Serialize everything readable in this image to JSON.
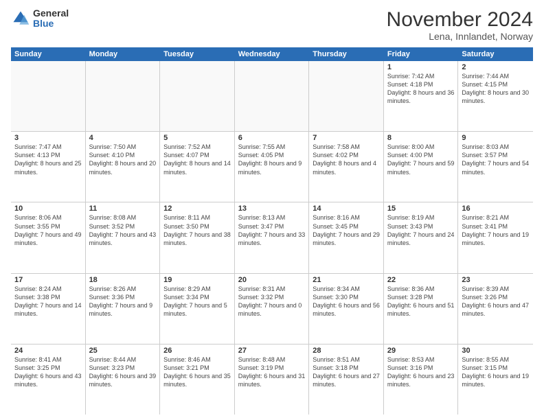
{
  "logo": {
    "general": "General",
    "blue": "Blue"
  },
  "title": "November 2024",
  "subtitle": "Lena, Innlandet, Norway",
  "header_days": [
    "Sunday",
    "Monday",
    "Tuesday",
    "Wednesday",
    "Thursday",
    "Friday",
    "Saturday"
  ],
  "rows": [
    [
      {
        "day": "",
        "detail": "",
        "empty": true
      },
      {
        "day": "",
        "detail": "",
        "empty": true
      },
      {
        "day": "",
        "detail": "",
        "empty": true
      },
      {
        "day": "",
        "detail": "",
        "empty": true
      },
      {
        "day": "",
        "detail": "",
        "empty": true
      },
      {
        "day": "1",
        "detail": "Sunrise: 7:42 AM\nSunset: 4:18 PM\nDaylight: 8 hours\nand 36 minutes.",
        "empty": false
      },
      {
        "day": "2",
        "detail": "Sunrise: 7:44 AM\nSunset: 4:15 PM\nDaylight: 8 hours\nand 30 minutes.",
        "empty": false
      }
    ],
    [
      {
        "day": "3",
        "detail": "Sunrise: 7:47 AM\nSunset: 4:13 PM\nDaylight: 8 hours\nand 25 minutes.",
        "empty": false
      },
      {
        "day": "4",
        "detail": "Sunrise: 7:50 AM\nSunset: 4:10 PM\nDaylight: 8 hours\nand 20 minutes.",
        "empty": false
      },
      {
        "day": "5",
        "detail": "Sunrise: 7:52 AM\nSunset: 4:07 PM\nDaylight: 8 hours\nand 14 minutes.",
        "empty": false
      },
      {
        "day": "6",
        "detail": "Sunrise: 7:55 AM\nSunset: 4:05 PM\nDaylight: 8 hours\nand 9 minutes.",
        "empty": false
      },
      {
        "day": "7",
        "detail": "Sunrise: 7:58 AM\nSunset: 4:02 PM\nDaylight: 8 hours\nand 4 minutes.",
        "empty": false
      },
      {
        "day": "8",
        "detail": "Sunrise: 8:00 AM\nSunset: 4:00 PM\nDaylight: 7 hours\nand 59 minutes.",
        "empty": false
      },
      {
        "day": "9",
        "detail": "Sunrise: 8:03 AM\nSunset: 3:57 PM\nDaylight: 7 hours\nand 54 minutes.",
        "empty": false
      }
    ],
    [
      {
        "day": "10",
        "detail": "Sunrise: 8:06 AM\nSunset: 3:55 PM\nDaylight: 7 hours\nand 49 minutes.",
        "empty": false
      },
      {
        "day": "11",
        "detail": "Sunrise: 8:08 AM\nSunset: 3:52 PM\nDaylight: 7 hours\nand 43 minutes.",
        "empty": false
      },
      {
        "day": "12",
        "detail": "Sunrise: 8:11 AM\nSunset: 3:50 PM\nDaylight: 7 hours\nand 38 minutes.",
        "empty": false
      },
      {
        "day": "13",
        "detail": "Sunrise: 8:13 AM\nSunset: 3:47 PM\nDaylight: 7 hours\nand 33 minutes.",
        "empty": false
      },
      {
        "day": "14",
        "detail": "Sunrise: 8:16 AM\nSunset: 3:45 PM\nDaylight: 7 hours\nand 29 minutes.",
        "empty": false
      },
      {
        "day": "15",
        "detail": "Sunrise: 8:19 AM\nSunset: 3:43 PM\nDaylight: 7 hours\nand 24 minutes.",
        "empty": false
      },
      {
        "day": "16",
        "detail": "Sunrise: 8:21 AM\nSunset: 3:41 PM\nDaylight: 7 hours\nand 19 minutes.",
        "empty": false
      }
    ],
    [
      {
        "day": "17",
        "detail": "Sunrise: 8:24 AM\nSunset: 3:38 PM\nDaylight: 7 hours\nand 14 minutes.",
        "empty": false
      },
      {
        "day": "18",
        "detail": "Sunrise: 8:26 AM\nSunset: 3:36 PM\nDaylight: 7 hours\nand 9 minutes.",
        "empty": false
      },
      {
        "day": "19",
        "detail": "Sunrise: 8:29 AM\nSunset: 3:34 PM\nDaylight: 7 hours\nand 5 minutes.",
        "empty": false
      },
      {
        "day": "20",
        "detail": "Sunrise: 8:31 AM\nSunset: 3:32 PM\nDaylight: 7 hours\nand 0 minutes.",
        "empty": false
      },
      {
        "day": "21",
        "detail": "Sunrise: 8:34 AM\nSunset: 3:30 PM\nDaylight: 6 hours\nand 56 minutes.",
        "empty": false
      },
      {
        "day": "22",
        "detail": "Sunrise: 8:36 AM\nSunset: 3:28 PM\nDaylight: 6 hours\nand 51 minutes.",
        "empty": false
      },
      {
        "day": "23",
        "detail": "Sunrise: 8:39 AM\nSunset: 3:26 PM\nDaylight: 6 hours\nand 47 minutes.",
        "empty": false
      }
    ],
    [
      {
        "day": "24",
        "detail": "Sunrise: 8:41 AM\nSunset: 3:25 PM\nDaylight: 6 hours\nand 43 minutes.",
        "empty": false
      },
      {
        "day": "25",
        "detail": "Sunrise: 8:44 AM\nSunset: 3:23 PM\nDaylight: 6 hours\nand 39 minutes.",
        "empty": false
      },
      {
        "day": "26",
        "detail": "Sunrise: 8:46 AM\nSunset: 3:21 PM\nDaylight: 6 hours\nand 35 minutes.",
        "empty": false
      },
      {
        "day": "27",
        "detail": "Sunrise: 8:48 AM\nSunset: 3:19 PM\nDaylight: 6 hours\nand 31 minutes.",
        "empty": false
      },
      {
        "day": "28",
        "detail": "Sunrise: 8:51 AM\nSunset: 3:18 PM\nDaylight: 6 hours\nand 27 minutes.",
        "empty": false
      },
      {
        "day": "29",
        "detail": "Sunrise: 8:53 AM\nSunset: 3:16 PM\nDaylight: 6 hours\nand 23 minutes.",
        "empty": false
      },
      {
        "day": "30",
        "detail": "Sunrise: 8:55 AM\nSunset: 3:15 PM\nDaylight: 6 hours\nand 19 minutes.",
        "empty": false
      }
    ]
  ]
}
